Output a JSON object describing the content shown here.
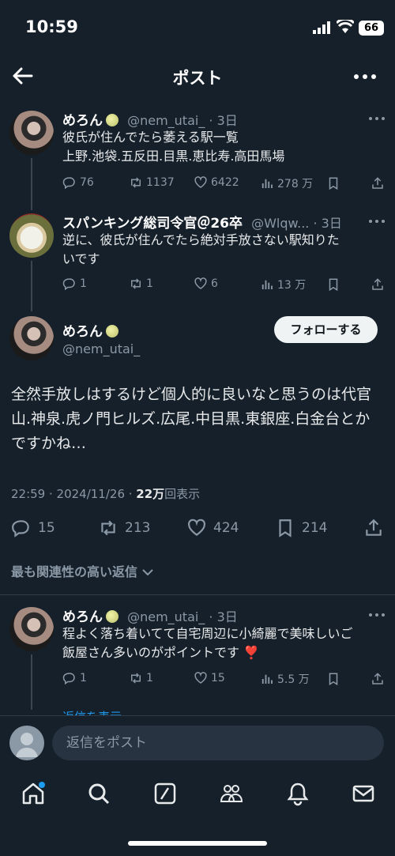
{
  "status": {
    "time": "10:59",
    "battery": "66"
  },
  "header": {
    "title": "ポスト"
  },
  "posts": [
    {
      "name": "めろん",
      "handle": "@nem_utai_",
      "age": "· 3日",
      "text1": "彼氏が住んでたら萎える駅一覧",
      "text2": "上野.池袋.五反田.目黒.恵比寿.高田馬場",
      "replies": "76",
      "reposts": "1137",
      "likes": "6422",
      "views": "278 万"
    },
    {
      "name": "スパンキング総司令官＠26卒",
      "handle": "@Wlqw...",
      "age": "· 3日",
      "text1": "逆に、彼氏が住んでたら絶対手放さない駅知りた",
      "text2": "いです",
      "replies": "1",
      "reposts": "1",
      "likes": "6",
      "views": "13 万"
    }
  ],
  "main": {
    "name": "めろん",
    "handle": "@nem_utai_",
    "follow_label": "フォローする",
    "text": "全然手放しはするけど個人的に良いなと思うのは代官山.神泉.虎ノ門ヒルズ.広尾.中目黒.東銀座.白金台とかですかね…",
    "timestamp": "22:59 · 2024/11/26 · ",
    "views_count": "22万",
    "views_label": "回表示",
    "replies": "15",
    "reposts": "213",
    "likes": "424",
    "bookmarks": "214"
  },
  "sort_label": "最も関連性の高い返信",
  "reply": {
    "name": "めろん",
    "handle": "@nem_utai_",
    "age": "· 3日",
    "text1": "程よく落ち着いてて自宅周辺に小綺麗で美味しいご",
    "text2": "飯屋さん多いのがポイントです",
    "emoji": "❣️",
    "replies": "1",
    "reposts": "1",
    "likes": "15",
    "views": "5.5 万",
    "more_replies": "返信を表示"
  },
  "compose": {
    "placeholder": "返信をポスト"
  },
  "icons": [
    "back-arrow-icon",
    "more-icon",
    "reply-icon",
    "repost-icon",
    "like-icon",
    "views-icon",
    "bookmark-icon",
    "share-icon",
    "home-icon",
    "search-icon",
    "grok-icon",
    "communities-icon",
    "notifications-icon",
    "messages-icon"
  ],
  "colors": {
    "background": "#15202b",
    "text": "#e7e9ea",
    "muted": "#8b98a5",
    "accent": "#1d9bf0",
    "heart": "#f91880"
  }
}
